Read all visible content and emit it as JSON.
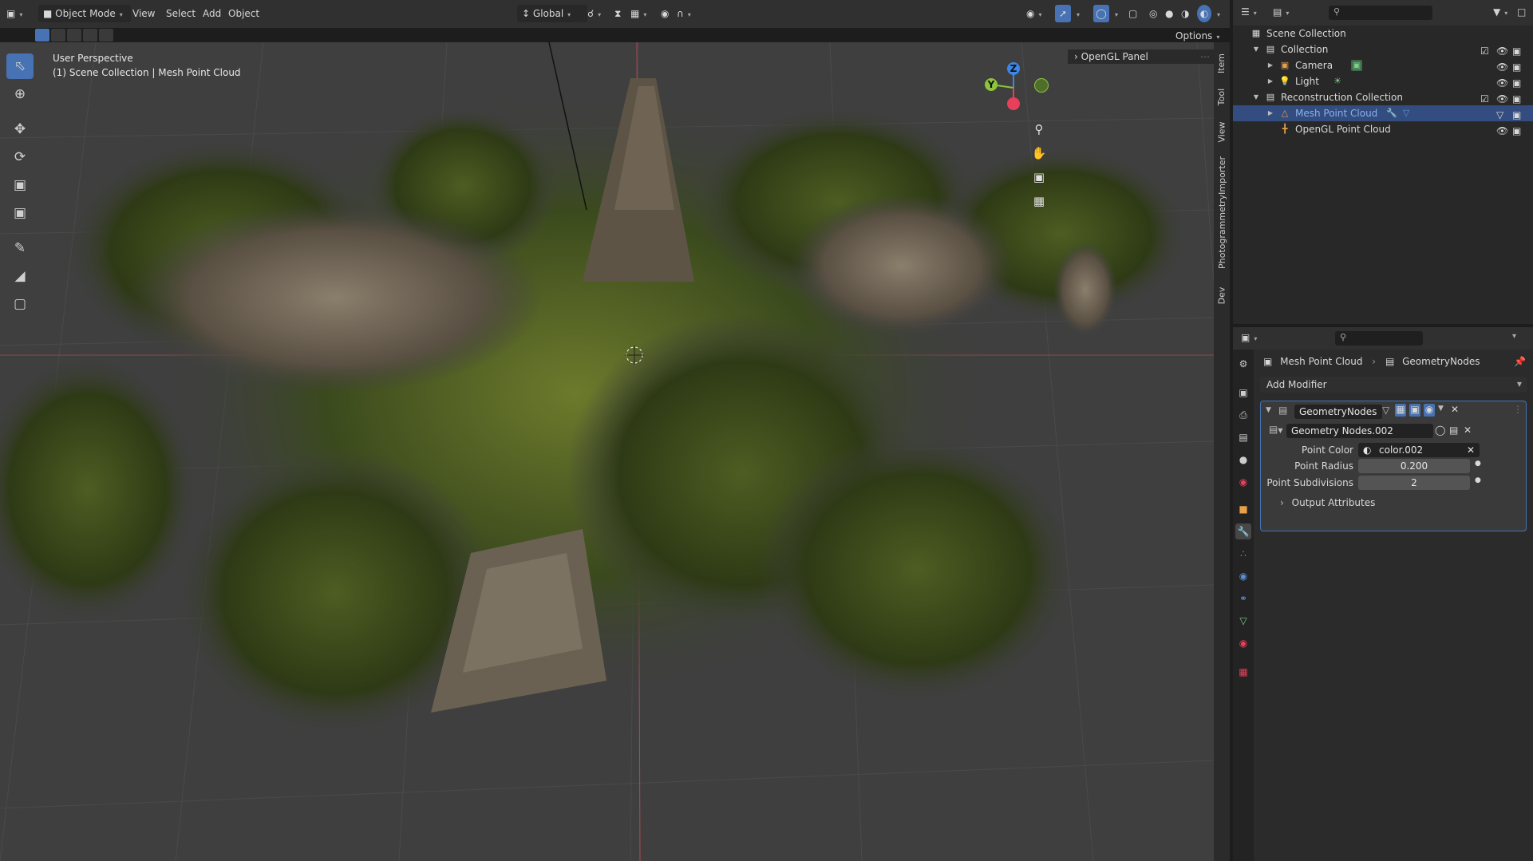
{
  "header": {
    "editor_type_icon": "viewport-icon",
    "mode": "Object Mode",
    "menus": [
      "View",
      "Select",
      "Add",
      "Object"
    ],
    "transform_orientation": "Global",
    "options_label": "Options"
  },
  "viewport": {
    "perspective_label": "User Perspective",
    "context_label": "(1) Scene Collection | Mesh Point Cloud",
    "opengl_panel_label": "OpenGL Panel",
    "gizmo": {
      "z": "Z",
      "y": "Y"
    }
  },
  "npanel_tabs": [
    "Item",
    "Tool",
    "View",
    "PhotogrammetryImporter",
    "Dev"
  ],
  "outliner": {
    "root": "Scene Collection",
    "rows": [
      {
        "label": "Collection",
        "icon": "collection-icon"
      },
      {
        "label": "Camera",
        "icon": "camera-icon"
      },
      {
        "label": "Light",
        "icon": "light-icon"
      },
      {
        "label": "Reconstruction Collection",
        "icon": "collection-icon"
      },
      {
        "label": "Mesh Point Cloud",
        "icon": "mesh-icon"
      },
      {
        "label": "OpenGL Point Cloud",
        "icon": "empty-icon"
      }
    ]
  },
  "properties": {
    "breadcrumb_object": "Mesh Point Cloud",
    "breadcrumb_modifier": "GeometryNodes",
    "add_modifier_label": "Add Modifier",
    "modifier_name": "GeometryNodes",
    "node_group": "Geometry Nodes.002",
    "point_color_label": "Point Color",
    "point_color_value": "color.002",
    "point_radius_label": "Point Radius",
    "point_radius_value": "0.200",
    "point_subdivisions_label": "Point Subdivisions",
    "point_subdivisions_value": "2",
    "output_attributes_label": "Output Attributes"
  },
  "colors": {
    "accent": "#4772b3",
    "selected_row": "#334d80",
    "axis_x": "#e8405a",
    "axis_y": "#8cc43c",
    "axis_z": "#3b86e8"
  }
}
